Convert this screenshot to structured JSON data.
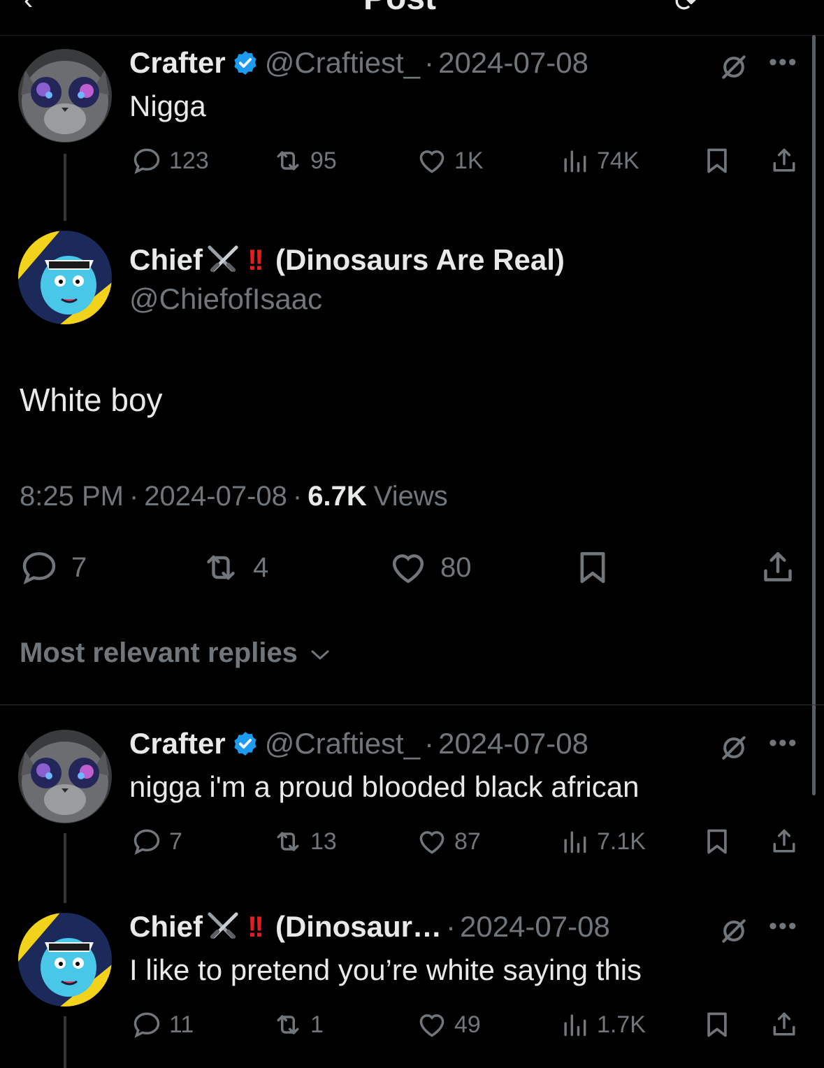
{
  "topbar": {
    "back_glyph": "‹",
    "title": "Post",
    "grok_glyph": "⟳"
  },
  "tweets": [
    {
      "name": "Crafter",
      "handle": "@Craftiest_",
      "sep": "·",
      "date": "2024-07-08",
      "text": "Nigga",
      "replies": "123",
      "reposts": "95",
      "likes": "1K",
      "views": "74K"
    },
    {
      "name": "Crafter",
      "handle": "@Craftiest_",
      "sep": "·",
      "date": "2024-07-08",
      "text": "nigga i'm a proud blooded black african",
      "replies": "7",
      "reposts": "13",
      "likes": "87",
      "views": "7.1K"
    },
    {
      "name": "Chief",
      "name_suffix": "(Dinosaur…",
      "bang": "!!",
      "sep": "·",
      "date": "2024-07-08",
      "text": "I like to pretend you’re white saying this",
      "replies": "11",
      "reposts": "1",
      "likes": "49",
      "views": "1.7K"
    }
  ],
  "main": {
    "name": "Chief",
    "bang": "!!",
    "name_suffix": "(Dinosaurs Are Real)",
    "handle": "@ChiefofIsaac",
    "text": "White boy",
    "time": "8:25 PM",
    "sep": "·",
    "date": "2024-07-08",
    "views_count": "6.7K",
    "views_label": "Views",
    "replies": "7",
    "reposts": "4",
    "likes": "80"
  },
  "sort": {
    "label": "Most relevant replies"
  },
  "colors": {
    "background": "#000000",
    "text": "#e7e9ea",
    "muted": "#71767b",
    "verified": "#1d9bf0",
    "bang": "#e0201f"
  },
  "icons": [
    "reply-icon",
    "repost-icon",
    "like-icon",
    "views-icon",
    "bookmark-icon",
    "share-icon",
    "more-icon",
    "grok-icon",
    "verified-icon",
    "swords-icon",
    "chevron-down-icon"
  ]
}
